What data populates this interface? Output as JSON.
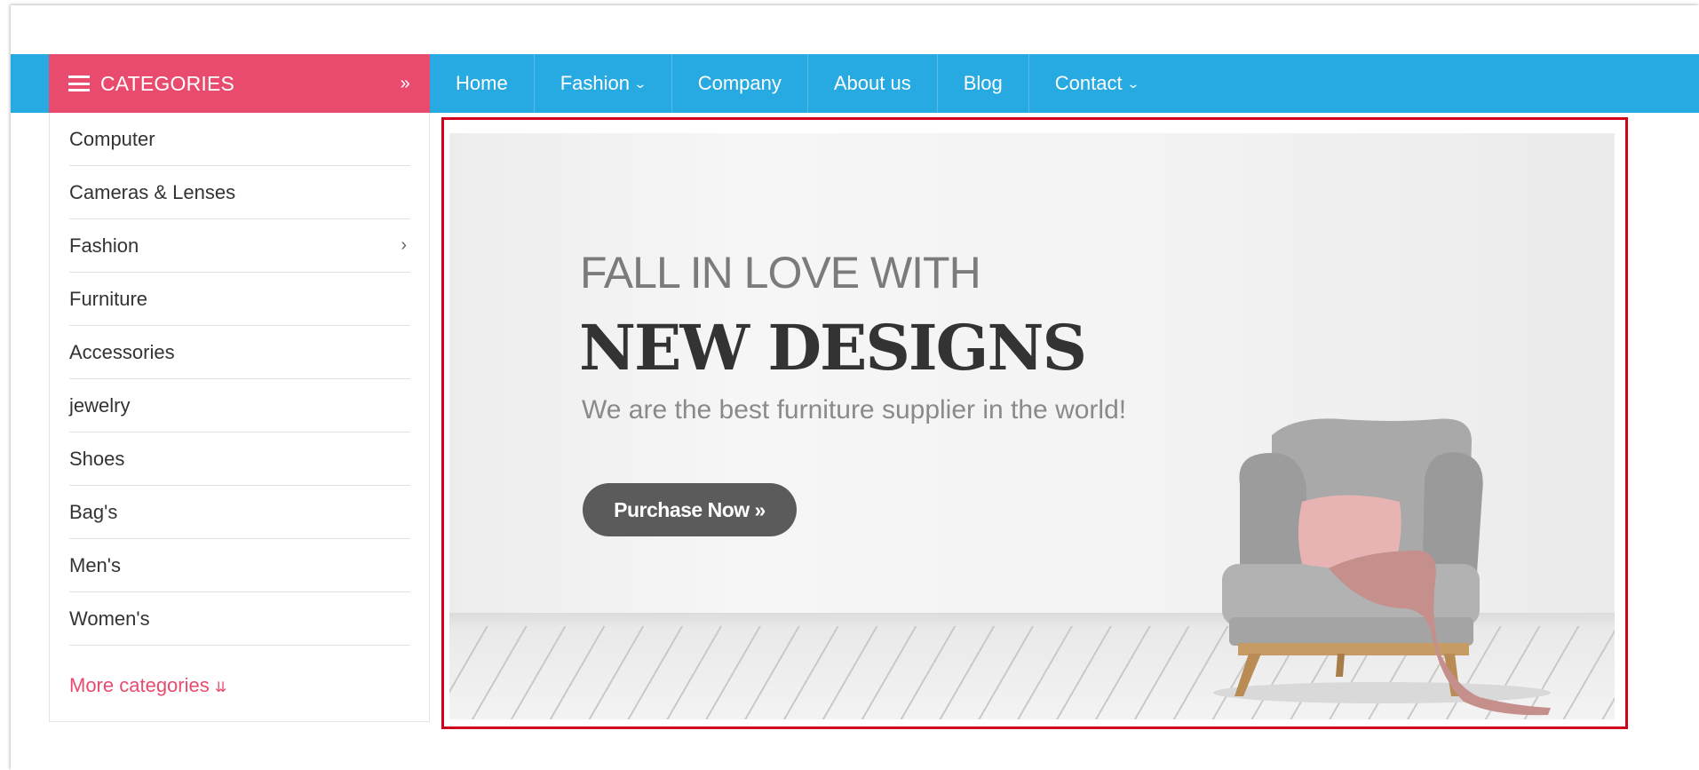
{
  "categories_header": {
    "label": "CATEGORIES",
    "icon": "menu-bars-icon",
    "toggle_icon": "double-chevron-down-icon"
  },
  "nav": {
    "items": [
      {
        "label": "Home",
        "has_dropdown": false
      },
      {
        "label": "Fashion",
        "has_dropdown": true
      },
      {
        "label": "Company",
        "has_dropdown": false
      },
      {
        "label": "About us",
        "has_dropdown": false
      },
      {
        "label": "Blog",
        "has_dropdown": false
      },
      {
        "label": "Contact",
        "has_dropdown": true
      }
    ]
  },
  "sidebar": {
    "items": [
      {
        "label": "Computer"
      },
      {
        "label": "Cameras & Lenses"
      },
      {
        "label": "Fashion",
        "has_submenu": true
      },
      {
        "label": "Furniture"
      },
      {
        "label": "Accessories"
      },
      {
        "label": "jewelry"
      },
      {
        "label": "Shoes"
      },
      {
        "label": "Bag's"
      },
      {
        "label": "Men's"
      },
      {
        "label": "Women's"
      }
    ],
    "more_label": "More categories"
  },
  "banner": {
    "subtitle": "FALL IN LOVE WITH",
    "title": "NEW DESIGNS",
    "description": "We are the best furniture supplier in the world!",
    "cta_label": "Purchase Now »"
  },
  "colors": {
    "nav_bg": "#27a9e1",
    "accent": "#e94b6e",
    "highlight_border": "#d0021b",
    "cta_bg": "#5b5b5b"
  }
}
